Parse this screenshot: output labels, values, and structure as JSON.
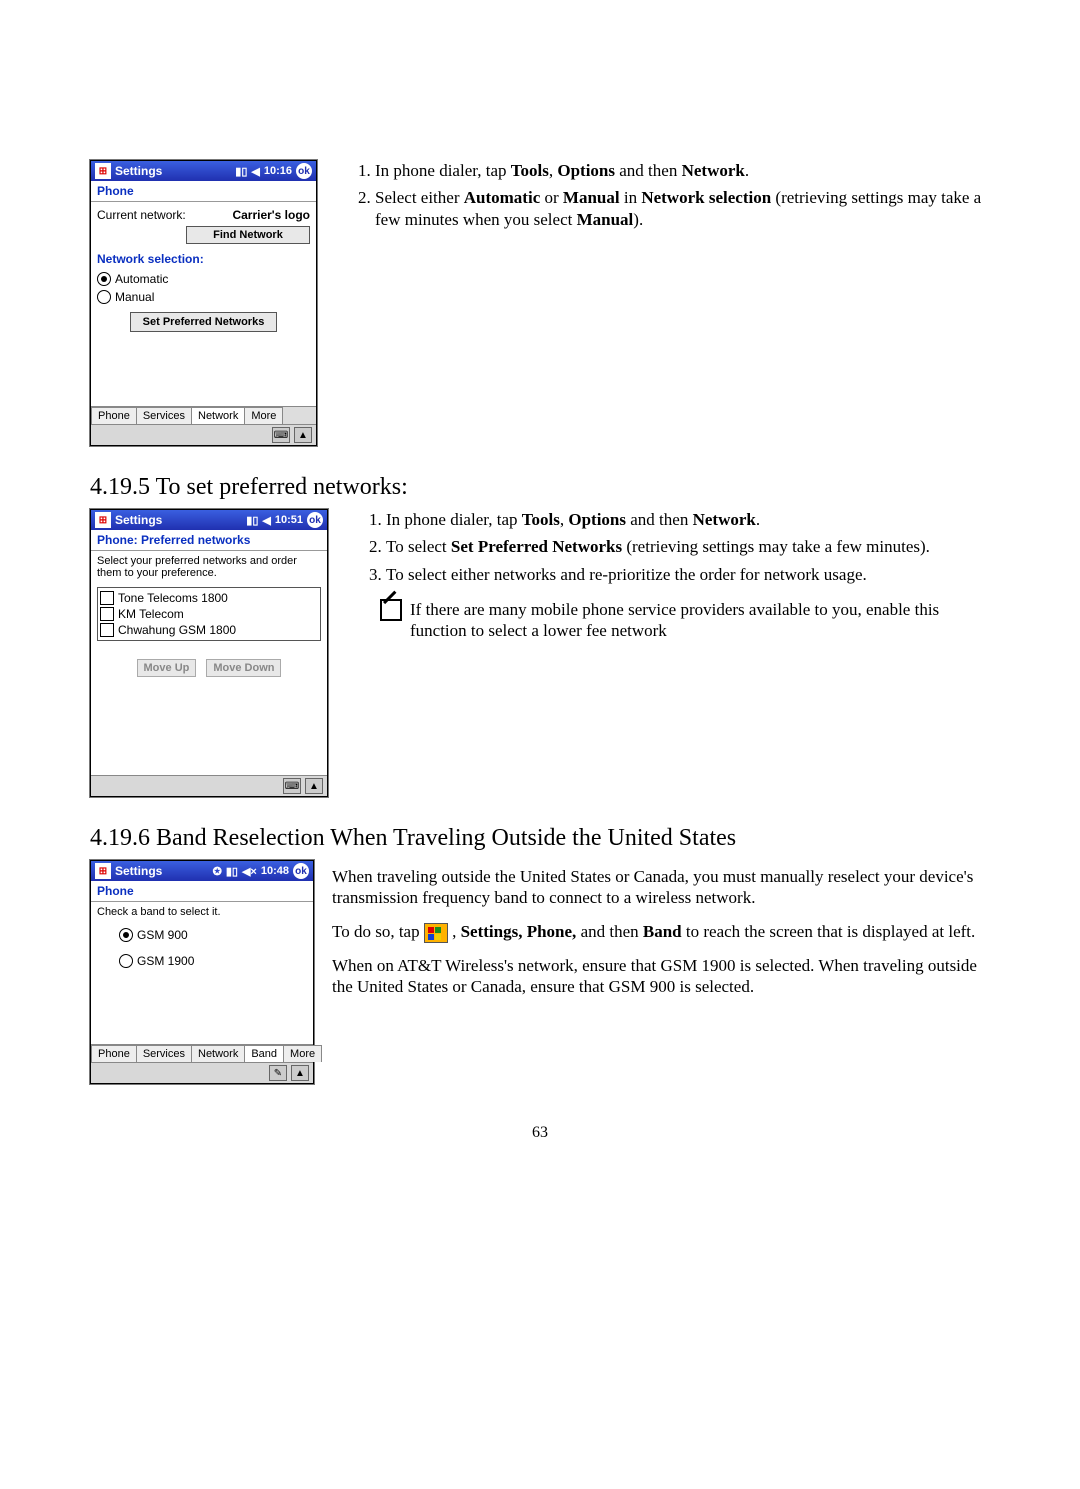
{
  "page_number": "63",
  "section_419": {
    "instruction1_prefix": "In phone dialer, tap ",
    "instruction1_tools": "Tools",
    "instruction1_mid1": ", ",
    "instruction1_options": "Options",
    "instruction1_mid2": " and then ",
    "instruction1_network": "Network",
    "instruction1_suffix": ".",
    "instruction2_prefix": "Select either ",
    "instruction2_auto": "Automatic",
    "instruction2_or": " or ",
    "instruction2_manual": "Manual",
    "instruction2_in": " in ",
    "instruction2_netsel": "Network selection",
    "instruction2_rest": " (retrieving settings may take a few minutes when you select ",
    "instruction2_manual2": "Manual",
    "instruction2_end": ")."
  },
  "shot1": {
    "title": "Settings",
    "clock": "10:16",
    "ok": "ok",
    "subtitle": "Phone",
    "current_network_label": "Current network:",
    "current_network_value": "Carrier's logo",
    "find_network_btn": "Find Network",
    "netsel_label": "Network selection:",
    "radio_auto": "Automatic",
    "radio_manual": "Manual",
    "set_pref_btn": "Set Preferred Networks",
    "tabs": [
      "Phone",
      "Services",
      "Network",
      "More"
    ]
  },
  "heading_4195": "4.19.5 To set preferred networks:",
  "section_4195": {
    "li1_a": "In phone dialer, tap ",
    "li1_tools": "Tools",
    "li1_c": ", ",
    "li1_options": "Options",
    "li1_d": " and then ",
    "li1_network": "Network",
    "li1_e": ".",
    "li2_a": "To select ",
    "li2_b": "Set Preferred Networks",
    "li2_c": " (retrieving settings may take a few minutes).",
    "li3": "To select either networks and re-prioritize the order for network usage.",
    "note": "If there are many mobile phone service providers available to you, enable this function to select a lower fee network"
  },
  "shot2": {
    "title": "Settings",
    "clock": "10:51",
    "ok": "ok",
    "subtitle": "Phone: Preferred networks",
    "instr": "Select your preferred networks and order them to your preference.",
    "networks": [
      "Tone Telecoms 1800",
      "KM Telecom",
      "Chwahung GSM 1800"
    ],
    "move_up": "Move Up",
    "move_down": "Move Down"
  },
  "heading_4196": "4.19.6 Band Reselection When Traveling Outside the United States",
  "section_4196": {
    "p1": "When traveling outside the United States or Canada, you must manually reselect your device's transmission frequency band to connect to a wireless network.",
    "p2_a": "To do so, tap ",
    "p2_b": " , ",
    "p2_settings": "Settings, Phone,",
    "p2_c": " and then ",
    "p2_band": "Band",
    "p2_d": " to reach the screen that is displayed at left.",
    "p3": "When on AT&T Wireless's network, ensure that GSM 1900 is selected.  When traveling outside the United States or Canada, ensure that GSM 900 is selected."
  },
  "shot3": {
    "title": "Settings",
    "clock": "10:48",
    "ok": "ok",
    "subtitle": "Phone",
    "instr": "Check a band to select it.",
    "gsm900": "GSM 900",
    "gsm1900": "GSM 1900",
    "tabs": [
      "Phone",
      "Services",
      "Network",
      "Band",
      "More"
    ]
  }
}
